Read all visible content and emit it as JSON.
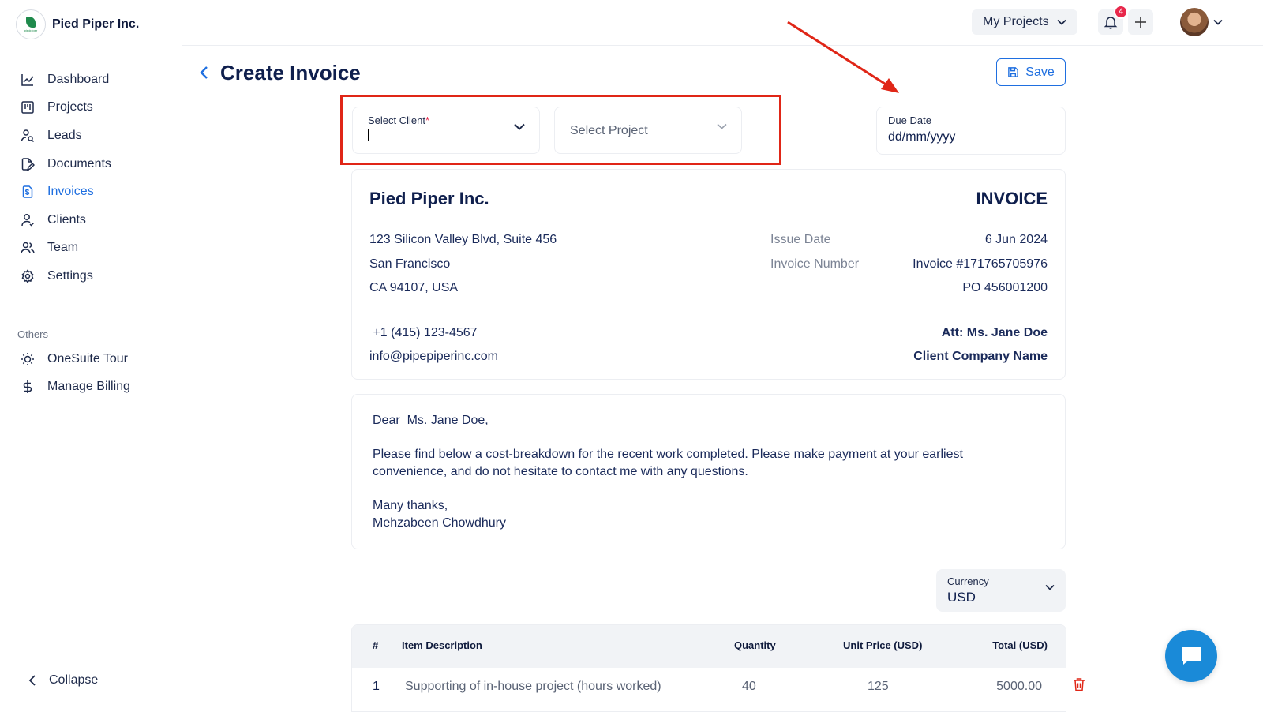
{
  "brand": {
    "name": "Pied Piper Inc.",
    "logo_text": "piedpiper"
  },
  "nav": {
    "items": [
      {
        "label": "Dashboard",
        "icon": "chart-line-icon"
      },
      {
        "label": "Projects",
        "icon": "kanban-icon"
      },
      {
        "label": "Leads",
        "icon": "user-search-icon"
      },
      {
        "label": "Documents",
        "icon": "document-edit-icon"
      },
      {
        "label": "Invoices",
        "icon": "invoice-icon",
        "active": true
      },
      {
        "label": "Clients",
        "icon": "user-icon"
      },
      {
        "label": "Team",
        "icon": "users-icon"
      },
      {
        "label": "Settings",
        "icon": "gear-icon"
      }
    ],
    "others_title": "Others",
    "others": [
      {
        "label": "OneSuite Tour",
        "icon": "sun-icon"
      },
      {
        "label": "Manage Billing",
        "icon": "dollar-icon"
      }
    ],
    "collapse_label": "Collapse"
  },
  "topbar": {
    "projects_label": "My Projects",
    "notification_count": "4"
  },
  "header": {
    "title": "Create Invoice",
    "save_label": "Save"
  },
  "form": {
    "client_label": "Select Client",
    "client_required": "*",
    "project_placeholder": "Select Project",
    "due_label": "Due Date",
    "due_value": "dd/mm/yyyy"
  },
  "invoice": {
    "company": "Pied Piper Inc.",
    "heading": "INVOICE",
    "address1": "123 Silicon Valley Blvd, Suite 456",
    "address2": "San Francisco",
    "address3": "CA 94107, USA",
    "phone": " +1 (415) 123-4567",
    "email": "info@pipepiperinc.com",
    "issue_label": "Issue Date",
    "issue_value": "6 Jun 2024",
    "number_label": "Invoice Number",
    "number_value": "Invoice #171765705976",
    "po": "PO 456001200",
    "attention": "Att: Ms. Jane Doe",
    "client_company": "Client Company Name"
  },
  "letter": {
    "greeting": "Dear  Ms. Jane Doe,",
    "body1": "Please find below a cost-breakdown for the recent work completed. Please make payment at your earliest",
    "body2": "convenience, and do not hesitate to contact me with any questions.",
    "closing": "Many thanks,",
    "signature": "Mehzabeen Chowdhury"
  },
  "currency": {
    "label": "Currency",
    "value": "USD"
  },
  "table": {
    "headers": [
      "#",
      "Item Description",
      "Quantity",
      "Unit Price (USD)",
      "Total (USD)"
    ],
    "rows": [
      {
        "num": "1",
        "description": "Supporting of in-house project (hours worked)",
        "quantity": "40",
        "unit_price": "125",
        "total": "5000.00"
      }
    ]
  },
  "colors": {
    "accent": "#1f6fe0",
    "highlight": "#e02617",
    "badge": "#e8284b",
    "text": "#0f1f4d"
  }
}
